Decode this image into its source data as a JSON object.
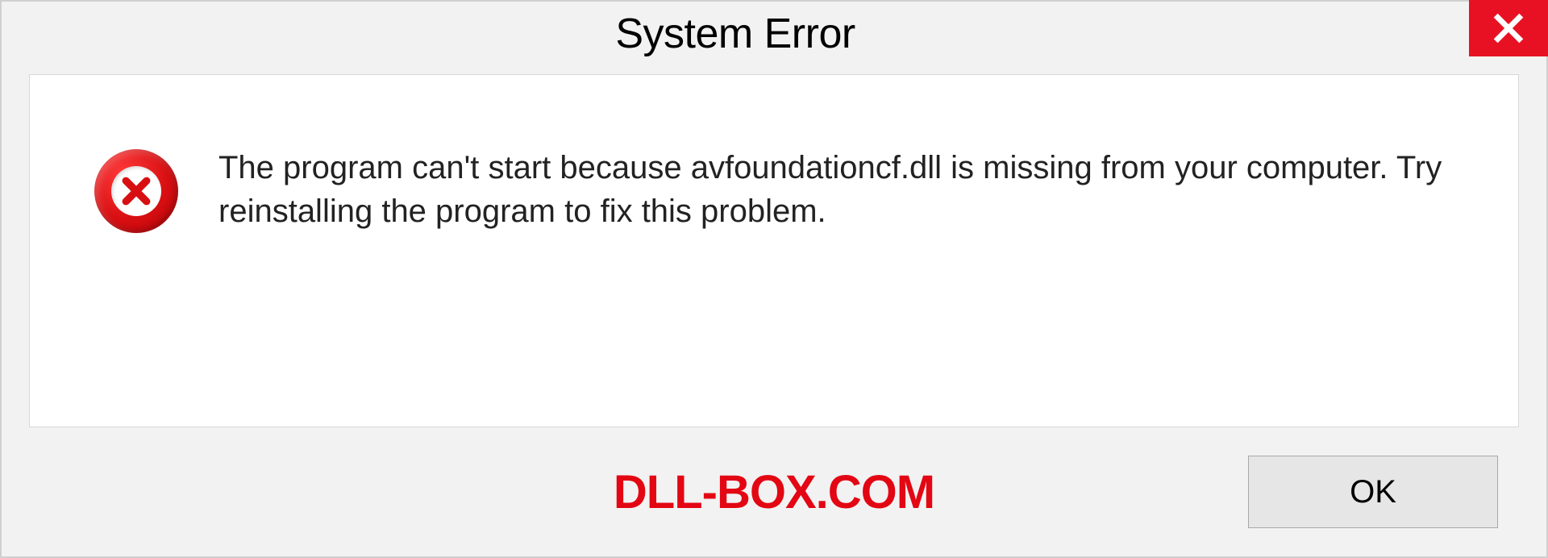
{
  "dialog": {
    "title": "System Error",
    "message": "The program can't start because avfoundationcf.dll is missing from your computer. Try reinstalling the program to fix this problem.",
    "ok_label": "OK"
  },
  "watermark": "DLL-BOX.COM",
  "colors": {
    "close_bg": "#e81123",
    "error_red": "#d80f12",
    "watermark_red": "#e30613"
  }
}
